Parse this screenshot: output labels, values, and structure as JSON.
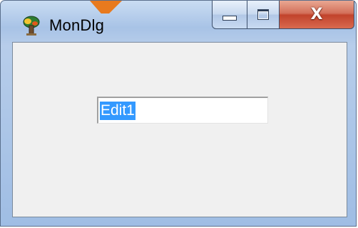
{
  "window": {
    "title": "MonDlg",
    "icon": "app-tree-icon",
    "accent_color": "#e87a1e"
  },
  "caption_buttons": {
    "minimize": "minimize-icon",
    "maximize": "maximize-icon",
    "close_glyph": "X"
  },
  "dialog": {
    "background": "#f0f0f0",
    "edit": {
      "value": "Edit1",
      "selected": true,
      "selection_color": "#3399ff"
    }
  }
}
